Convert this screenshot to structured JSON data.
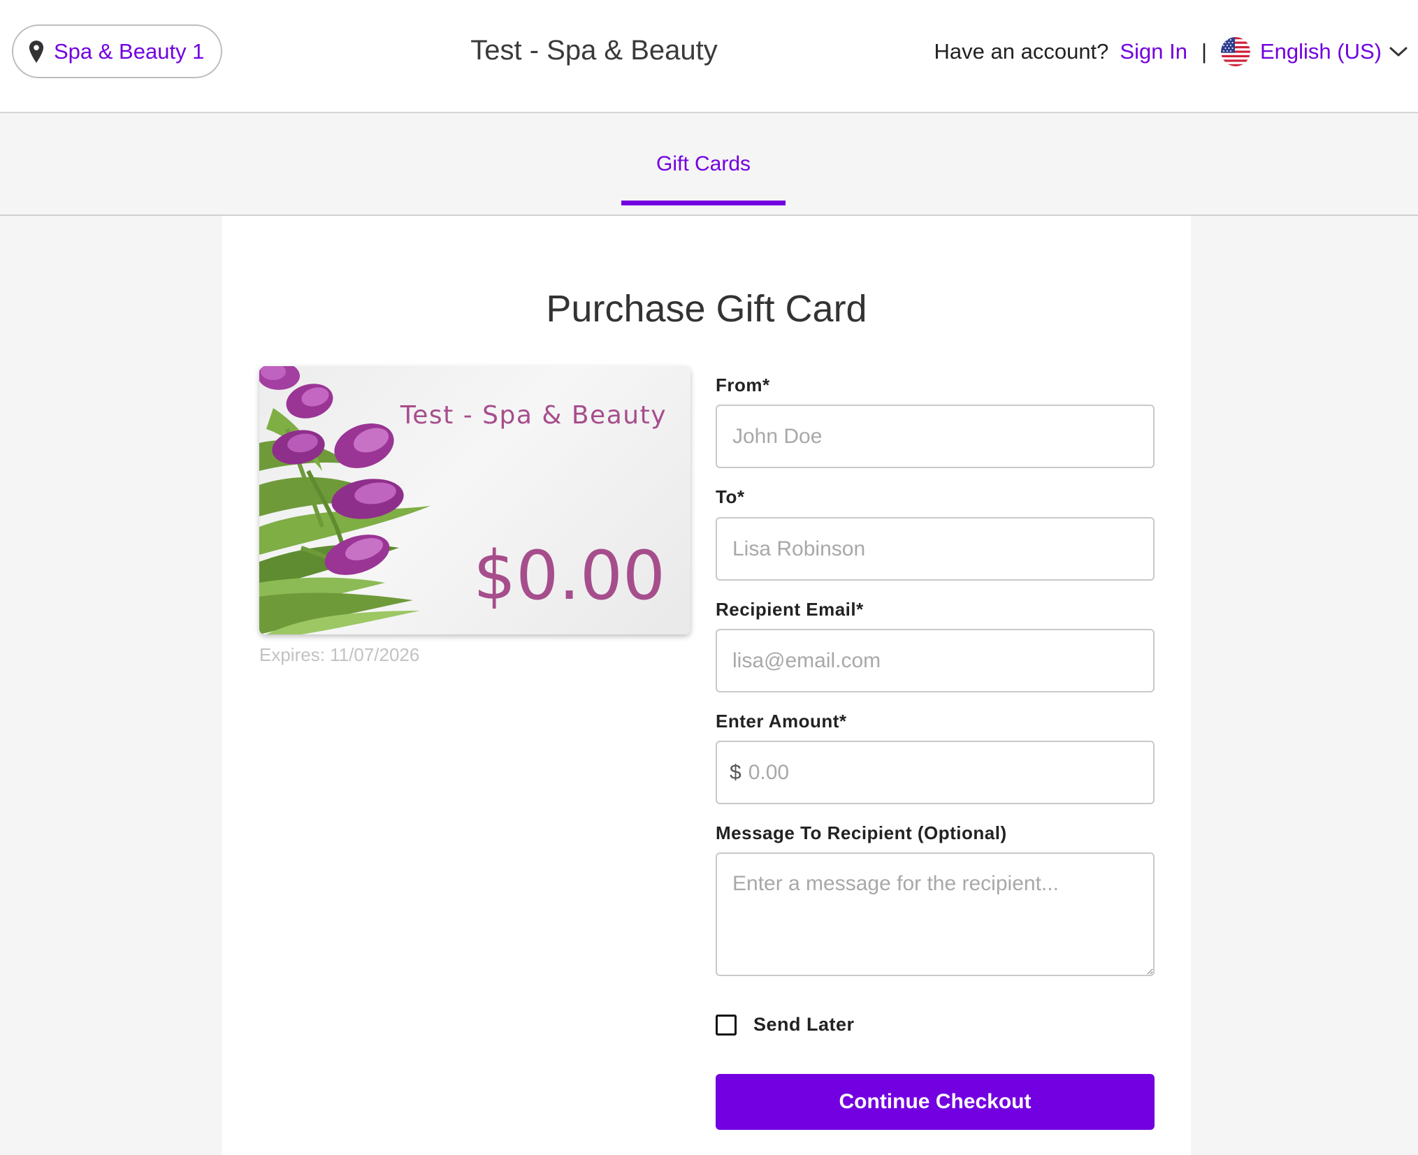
{
  "header": {
    "location_label": "Spa & Beauty 1",
    "site_title": "Test - Spa & Beauty",
    "account_prompt": "Have an account?",
    "sign_in_label": "Sign In",
    "separator": "|",
    "language_label": "English (US)"
  },
  "tabs": [
    {
      "label": "Gift Cards",
      "active": true
    }
  ],
  "main": {
    "page_title": "Purchase Gift Card",
    "card": {
      "business_name": "Test - Spa & Beauty",
      "amount": "$0.00",
      "expires": "Expires: 11/07/2026"
    },
    "form": {
      "from": {
        "label": "From*",
        "placeholder": "John Doe",
        "value": ""
      },
      "to": {
        "label": "To*",
        "placeholder": "Lisa Robinson",
        "value": ""
      },
      "recipient_email": {
        "label": "Recipient Email*",
        "placeholder": "lisa@email.com",
        "value": ""
      },
      "amount": {
        "label": "Enter Amount*",
        "currency_symbol": "$",
        "placeholder": "0.00",
        "value": ""
      },
      "message": {
        "label": "Message To Recipient (Optional)",
        "placeholder": "Enter a message for the recipient...",
        "value": ""
      },
      "send_later": {
        "label": "Send Later",
        "checked": false
      },
      "submit_label": "Continue Checkout"
    }
  },
  "colors": {
    "accent": "#7200e0",
    "card_text": "#a64d8c",
    "background": "#f5f5f5"
  },
  "icons": {
    "location": "map-pin-icon",
    "language_flag": "us-flag-icon",
    "language_dropdown": "chevron-down-icon"
  }
}
